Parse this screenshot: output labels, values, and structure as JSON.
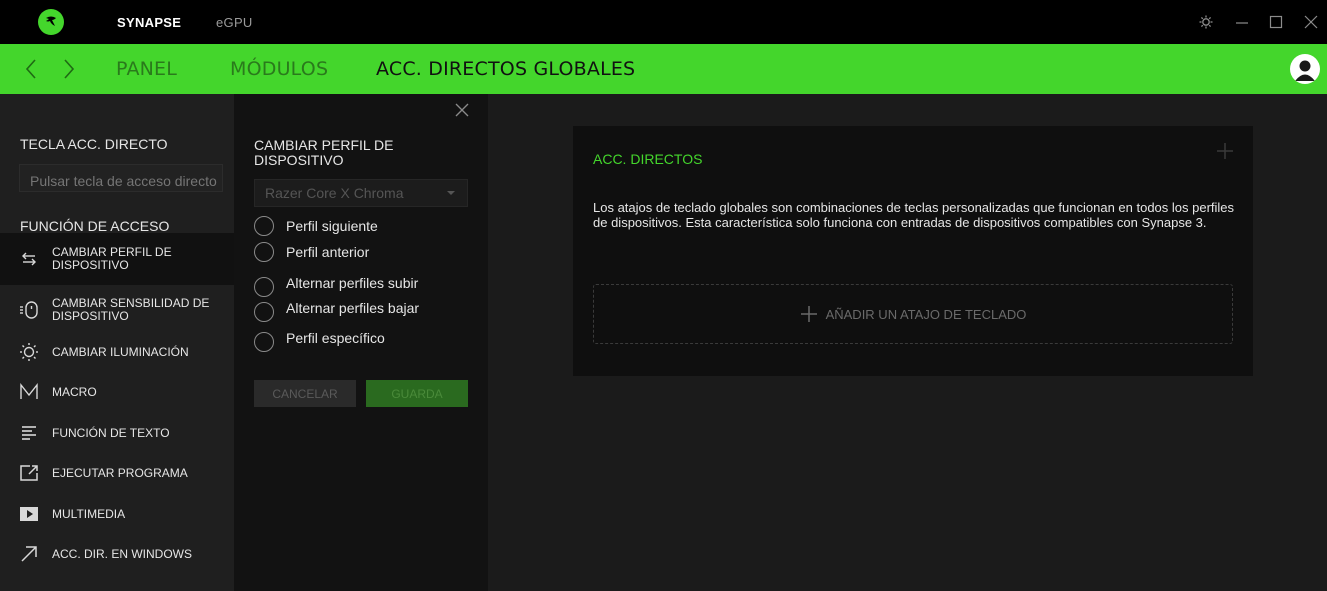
{
  "titlebar": {
    "app_name": "SYNAPSE",
    "tab": "eGPU",
    "icons": [
      "razer-logo-icon",
      "settings-icon",
      "minimize-icon",
      "maximize-icon",
      "close-icon"
    ]
  },
  "nav": {
    "links": [
      "PANEL",
      "MÓDULOS",
      "ACC. DIRECTOS GLOBALES"
    ],
    "active": "ACC. DIRECTOS GLOBALES"
  },
  "sidebar": {
    "hotkey_heading": "TECLA ACC. DIRECTO",
    "hotkey_placeholder": "Pulsar tecla de acceso directo",
    "function_heading": "FUNCIÓN DE ACCESO DIRECTO",
    "items": [
      {
        "label": "CAMBIAR PERFIL DE DISPOSITIVO",
        "icon": "switch-profile-icon",
        "active": true
      },
      {
        "label": "CAMBIAR SENSBILIDAD DE DISPOSITIVO",
        "icon": "sensitivity-icon",
        "active": false
      },
      {
        "label": "CAMBIAR ILUMINACIÓN",
        "icon": "lighting-icon",
        "active": false
      },
      {
        "label": "MACRO",
        "icon": "macro-icon",
        "active": false
      },
      {
        "label": "FUNCIÓN DE TEXTO",
        "icon": "text-function-icon",
        "active": false
      },
      {
        "label": "EJECUTAR PROGRAMA",
        "icon": "launch-program-icon",
        "active": false
      },
      {
        "label": "MULTIMEDIA",
        "icon": "multimedia-icon",
        "active": false
      },
      {
        "label": "ACC. DIR. EN WINDOWS",
        "icon": "windows-shortcut-icon",
        "active": false
      }
    ]
  },
  "panel": {
    "title": "CAMBIAR PERFIL DE DISPOSITIVO",
    "device_select": "Razer Core X Chroma",
    "options": [
      "Perfil siguiente",
      "Perfil anterior",
      "Alternar perfiles subir",
      "Alternar perfiles bajar",
      "Perfil específico"
    ],
    "cancel_label": "CANCELAR",
    "save_label": "GUARDA"
  },
  "card": {
    "title": "ACC. DIRECTOS",
    "description": "Los atajos de teclado globales son combinaciones de teclas personalizadas que funcionan en todos los perfiles de dispositivos. Esta característica solo funciona con entradas de dispositivos compatibles con Synapse 3.",
    "add_label": "AÑADIR UN ATAJO DE TECLADO"
  },
  "colors": {
    "accent": "#44d62c",
    "background": "#1b1b1b",
    "titlebar": "#000000"
  }
}
